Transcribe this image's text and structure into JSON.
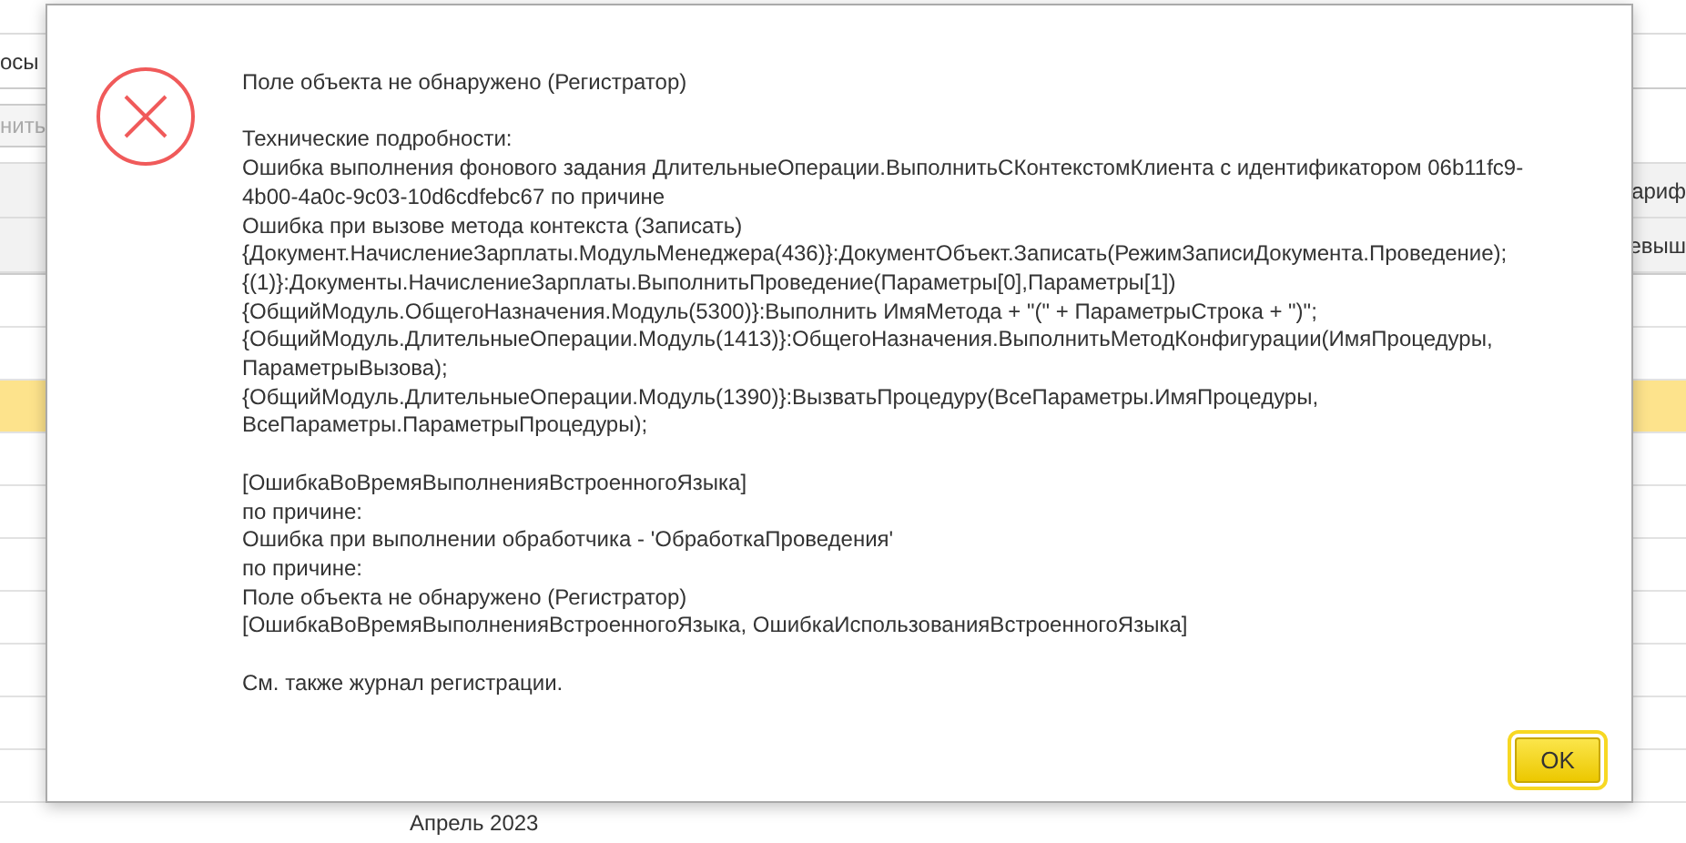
{
  "background": {
    "tab": "осы",
    "toolbar_button": {
      "label": "нить",
      "disabled": true
    },
    "header_cells": [
      "ариф",
      "евыш"
    ],
    "rows": [
      {
        "selected": false
      },
      {
        "selected": false
      },
      {
        "selected": true
      },
      {
        "selected": false
      },
      {
        "selected": false
      },
      {
        "selected": false
      },
      {
        "selected": false
      },
      {
        "selected": false
      },
      {
        "selected": false
      },
      {
        "selected": false
      }
    ],
    "footer_text": "Апрель 2023"
  },
  "dialog": {
    "paragraphs": [
      [
        "Поле объекта не обнаружено (Регистратор)"
      ],
      [
        "Технические подробности:",
        "Ошибка выполнения фонового задания ДлительныеОперации.ВыполнитьСКонтекстомКлиента с идентификатором 06b11fc9-",
        "4b00-4a0c-9c03-10d6cdfebc67 по причине",
        "Ошибка при вызове метода контекста (Записать)",
        "{Документ.НачислениеЗарплаты.МодульМенеджера(436)}:ДокументОбъект.Записать(РежимЗаписиДокумента.Проведение);",
        "{(1)}:Документы.НачислениеЗарплаты.ВыполнитьПроведение(Параметры[0],Параметры[1])",
        "{ОбщийМодуль.ОбщегоНазначения.Модуль(5300)}:Выполнить ИмяМетода + \"(\" + ПараметрыСтрока + \")\";",
        "{ОбщийМодуль.ДлительныеОперации.Модуль(1413)}:ОбщегоНазначения.ВыполнитьМетодКонфигурации(ИмяПроцедуры,",
        "ПараметрыВызова);",
        "{ОбщийМодуль.ДлительныеОперации.Модуль(1390)}:ВызватьПроцедуру(ВсеПараметры.ИмяПроцедуры,",
        "ВсеПараметры.ПараметрыПроцедуры);"
      ],
      [
        "[ОшибкаВоВремяВыполненияВстроенногоЯзыка]",
        "по причине:",
        "Ошибка при выполнении обработчика - 'ОбработкаПроведения'",
        "по причине:",
        "Поле объекта не обнаружено (Регистратор)",
        "[ОшибкаВоВремяВыполненияВстроенногоЯзыка, ОшибкаИспользованияВстроенногоЯзыка]"
      ],
      [
        "См. также журнал регистрации."
      ]
    ],
    "button": "OK"
  }
}
